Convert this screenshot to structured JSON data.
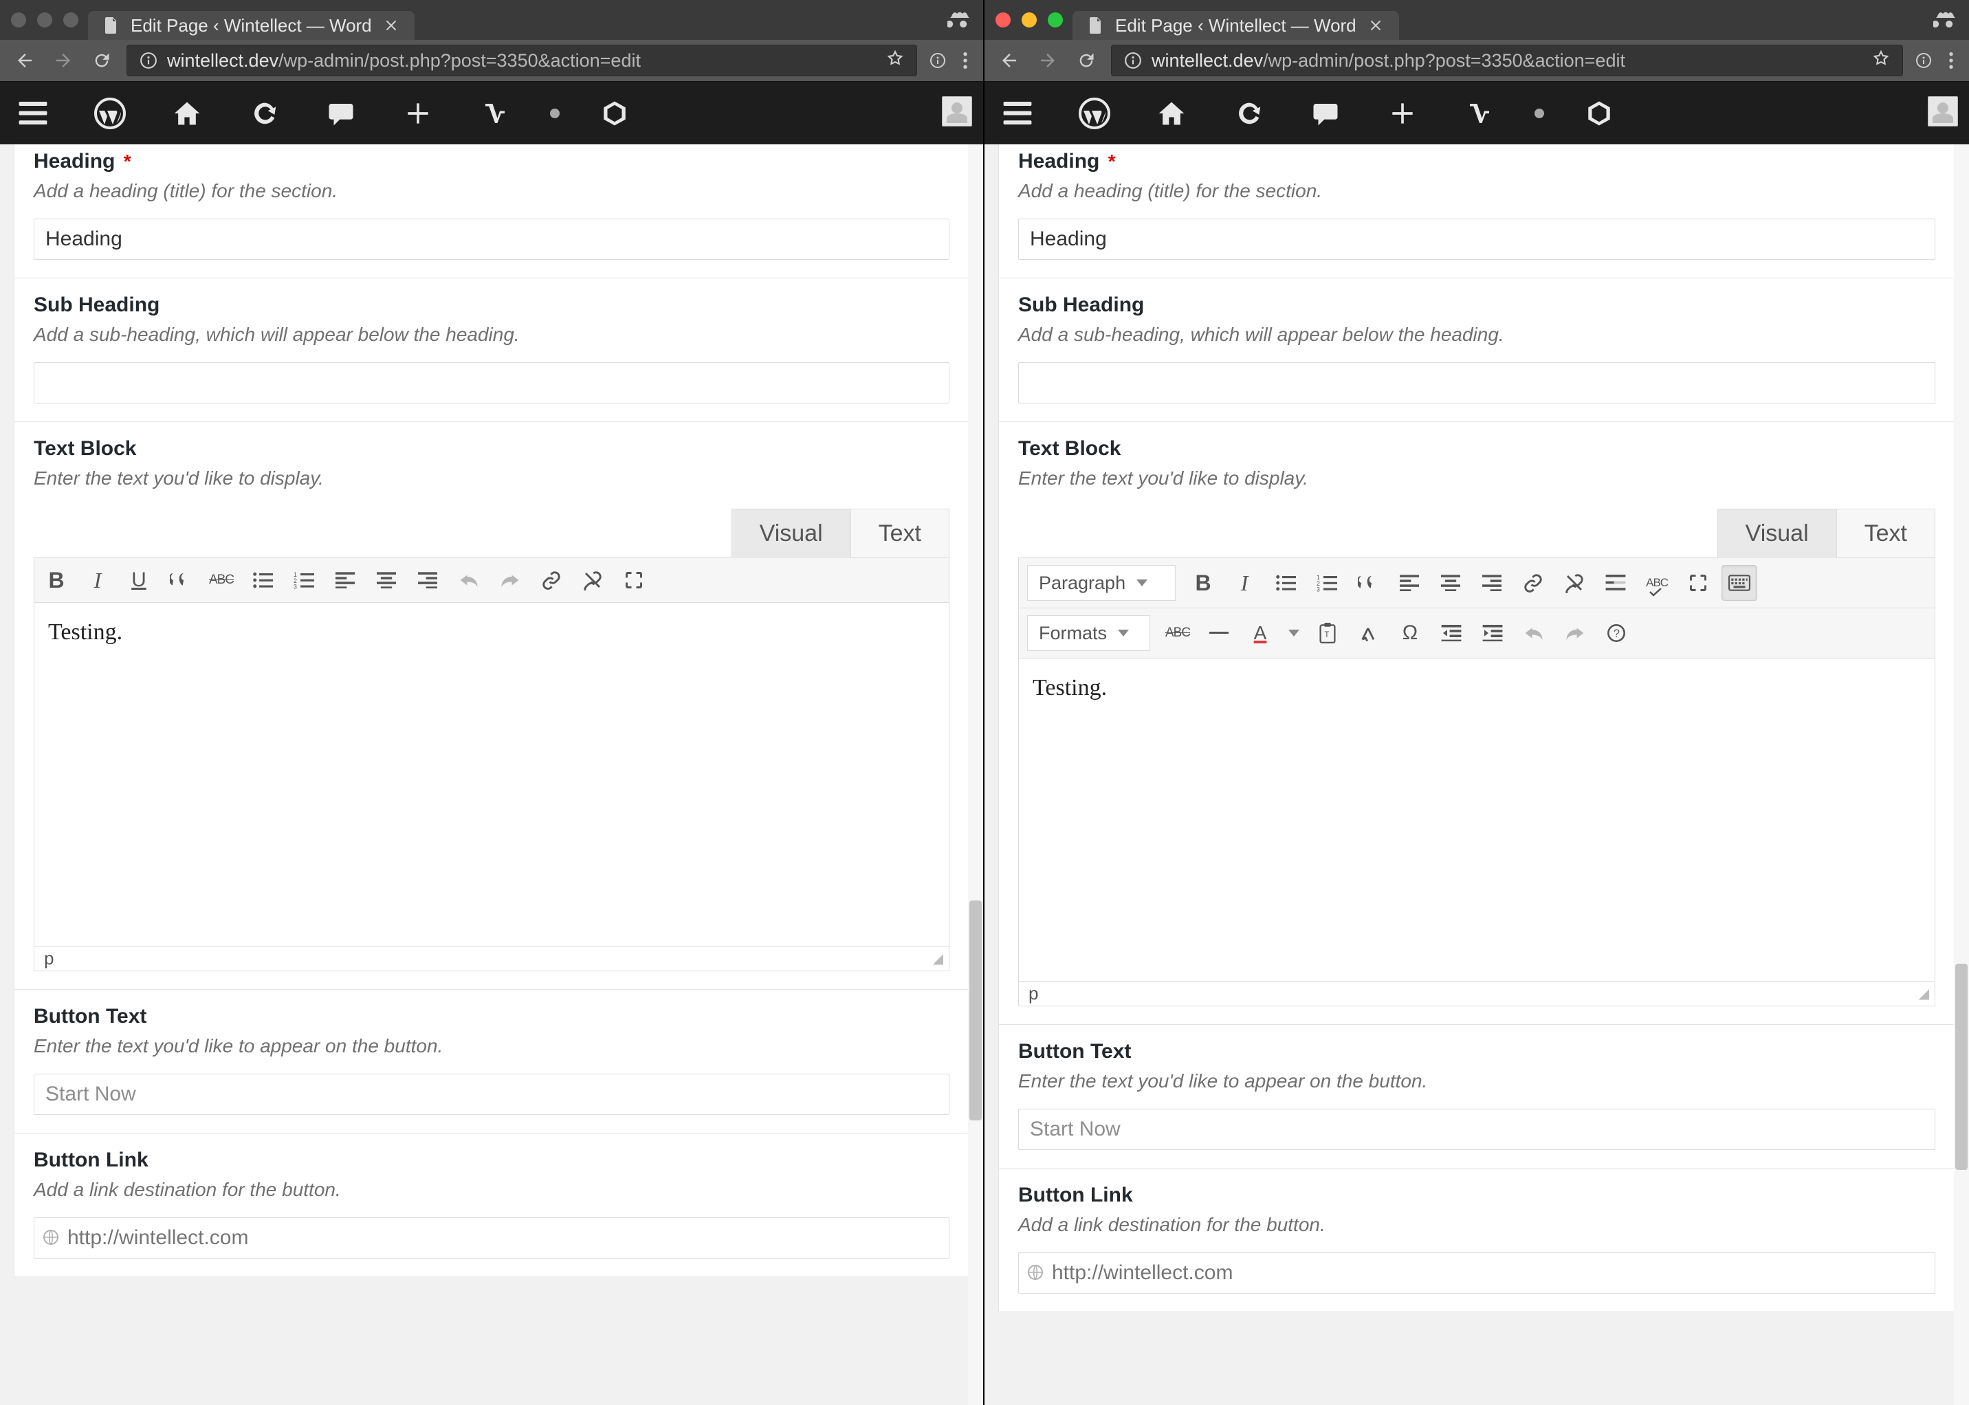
{
  "left": {
    "tab_title": "Edit Page ‹ Wintellect — Word",
    "url_prefix": "wintellect.dev",
    "url_rest": "/wp-admin/post.php?post=3350&action=edit",
    "fields": {
      "heading": {
        "label": "Heading",
        "required": "*",
        "desc": "Add a heading (title) for the section.",
        "value": "Heading"
      },
      "subheading": {
        "label": "Sub Heading",
        "desc": "Add a sub-heading, which will appear below the heading.",
        "value": ""
      },
      "textblock": {
        "label": "Text Block",
        "desc": "Enter the text you'd like to display.",
        "content": "Testing.",
        "status": "p"
      },
      "button_text": {
        "label": "Button Text",
        "desc": "Enter the text you'd like to appear on the button.",
        "placeholder": "Start Now",
        "value": ""
      },
      "button_link": {
        "label": "Button Link",
        "desc": "Add a link destination for the button.",
        "placeholder": "http://wintellect.com",
        "value": ""
      }
    },
    "editor_tabs": {
      "visual": "Visual",
      "text": "Text"
    }
  },
  "right": {
    "tab_title": "Edit Page ‹ Wintellect — Word",
    "url_prefix": "wintellect.dev",
    "url_rest": "/wp-admin/post.php?post=3350&action=edit",
    "fields": {
      "heading": {
        "label": "Heading",
        "required": "*",
        "desc": "Add a heading (title) for the section.",
        "value": "Heading"
      },
      "subheading": {
        "label": "Sub Heading",
        "desc": "Add a sub-heading, which will appear below the heading.",
        "value": ""
      },
      "textblock": {
        "label": "Text Block",
        "desc": "Enter the text you'd like to display.",
        "content": "Testing.",
        "status": "p"
      },
      "button_text": {
        "label": "Button Text",
        "desc": "Enter the text you'd like to appear on the button.",
        "placeholder": "Start Now",
        "value": ""
      },
      "button_link": {
        "label": "Button Link",
        "desc": "Add a link destination for the button.",
        "placeholder": "http://wintellect.com",
        "value": ""
      }
    },
    "editor_tabs": {
      "visual": "Visual",
      "text": "Text"
    },
    "format_select": "Paragraph",
    "formats_select": "Formats"
  }
}
